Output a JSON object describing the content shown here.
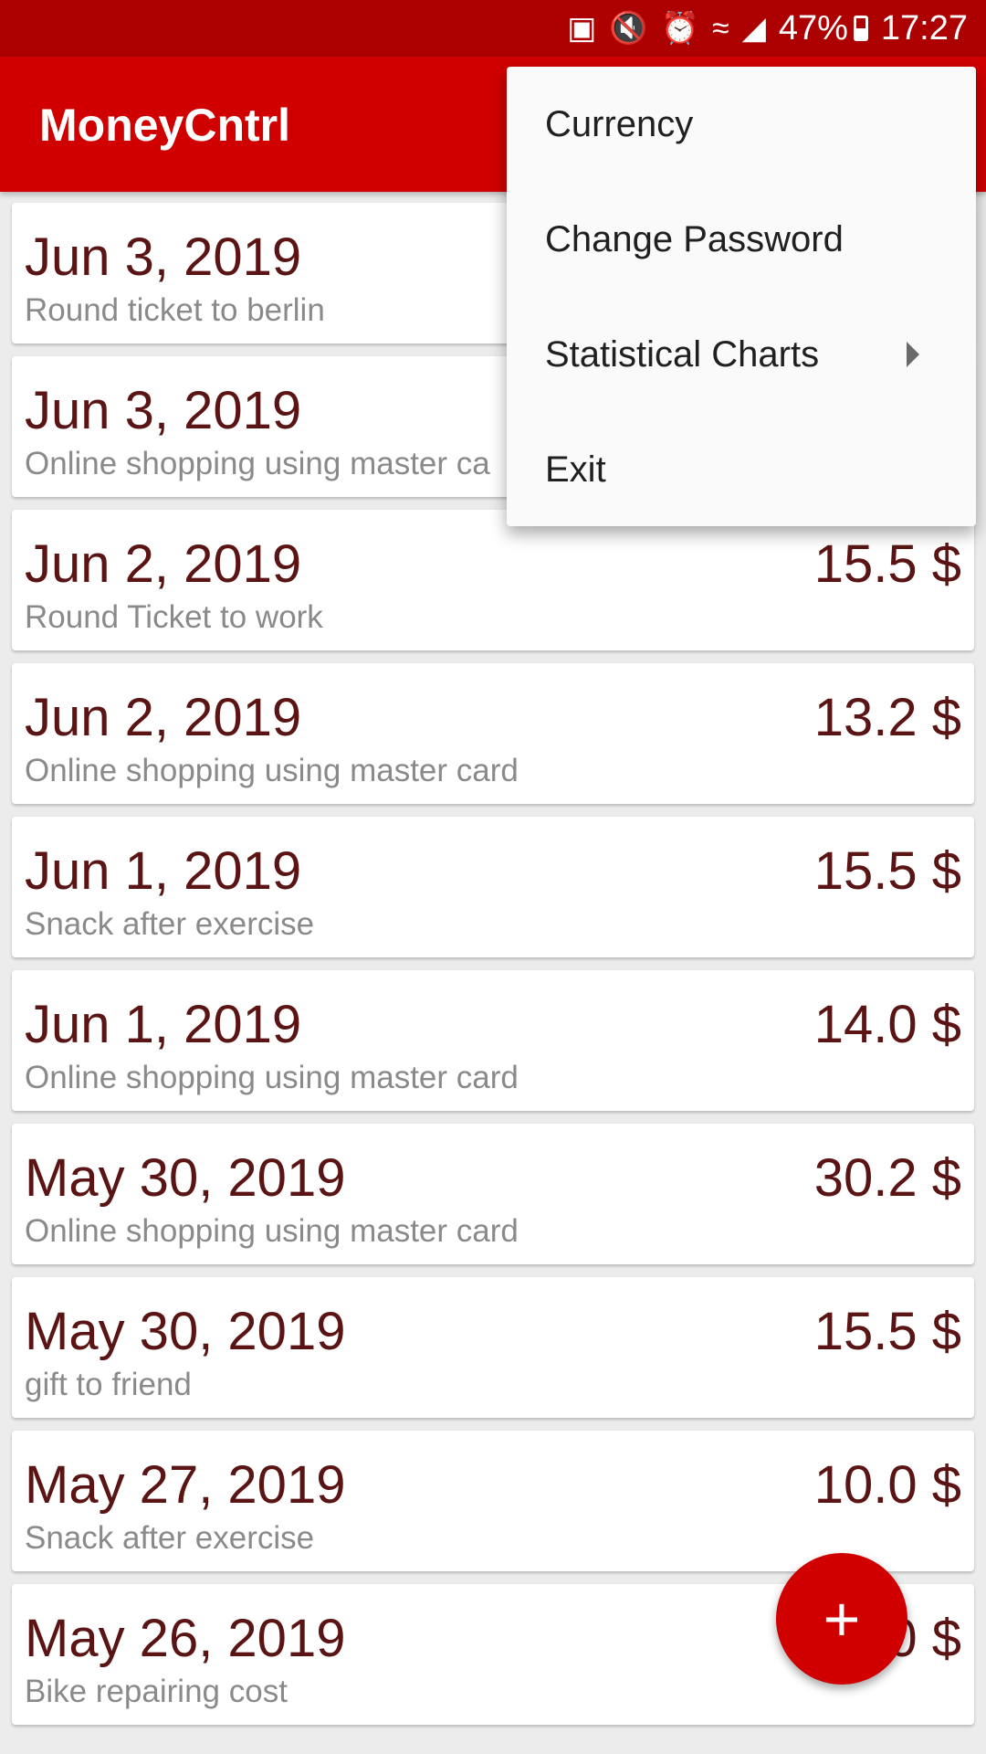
{
  "status_bar": {
    "icons": [
      "sim-card-icon",
      "mute-icon",
      "alarm-icon",
      "wifi-icon",
      "signal-icon"
    ],
    "battery": "47%",
    "time": "17:27"
  },
  "app_bar": {
    "title": "MoneyCntrl"
  },
  "menu": {
    "items": [
      {
        "label": "Currency"
      },
      {
        "label": "Change Password"
      },
      {
        "label": "Statistical Charts",
        "has_submenu": true
      },
      {
        "label": "Exit"
      }
    ]
  },
  "expenses": [
    {
      "date": "Jun 3, 2019",
      "desc": "Round ticket to berlin",
      "amount": ""
    },
    {
      "date": "Jun 3, 2019",
      "desc": "Online shopping using master ca",
      "amount": ""
    },
    {
      "date": "Jun 2, 2019",
      "desc": "Round Ticket to work",
      "amount": "15.5 $"
    },
    {
      "date": "Jun 2, 2019",
      "desc": "Online shopping using master card",
      "amount": "13.2 $"
    },
    {
      "date": "Jun 1, 2019",
      "desc": "Snack after exercise",
      "amount": "15.5 $"
    },
    {
      "date": "Jun 1, 2019",
      "desc": "Online shopping using master card",
      "amount": "14.0 $"
    },
    {
      "date": "May 30, 2019",
      "desc": "Online shopping using master card",
      "amount": "30.2 $"
    },
    {
      "date": "May 30, 2019",
      "desc": "gift to friend",
      "amount": "15.5 $"
    },
    {
      "date": "May 27, 2019",
      "desc": "Snack after exercise",
      "amount": "10.0 $"
    },
    {
      "date": "May 26, 2019",
      "desc": "Bike repairing cost",
      "amount": "0 $"
    }
  ],
  "fab": {
    "icon": "plus-icon",
    "glyph": "+"
  },
  "colors": {
    "status_bar": "#ad0000",
    "app_bar": "#d00000",
    "accent": "#d00000",
    "date_text": "#5a1414",
    "desc_text": "#8a8a8a"
  }
}
